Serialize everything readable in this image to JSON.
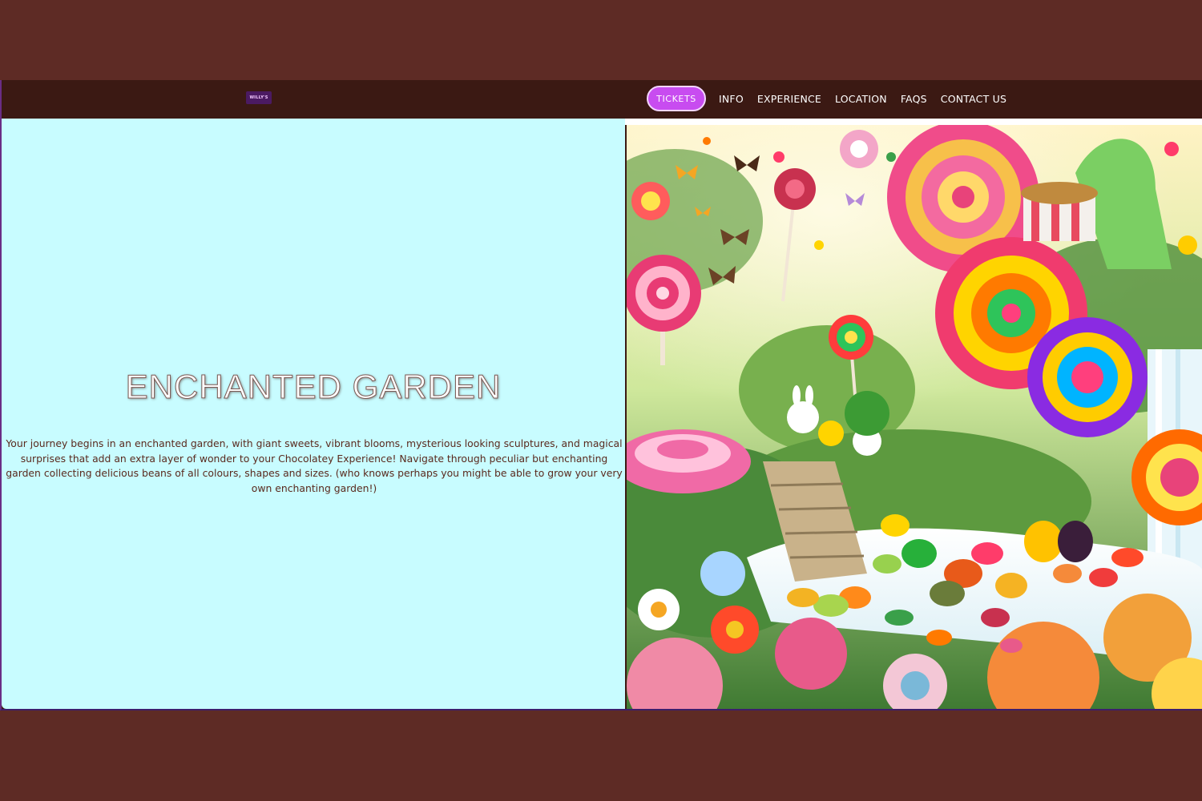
{
  "nav": {
    "logo_text": "WILLY'S",
    "tickets_label": "TICKETS",
    "items": [
      {
        "label": "INFO"
      },
      {
        "label": "EXPERIENCE"
      },
      {
        "label": "LOCATION"
      },
      {
        "label": "FAQS"
      },
      {
        "label": "CONTACT US"
      }
    ]
  },
  "main": {
    "heading": "ENCHANTED GARDEN",
    "paragraph": "Your journey begins in an enchanted garden, with giant  sweets, vibrant blooms, mysterious looking sculptures, and magical surprises that add an extra layer of wonder to your  Chocolatey Experience!  Navigate through peculiar but enchanting garden collecting delicious beans of all colours, shapes  and sizes.  (who knows perhaps you might be able to grow your very own enchanting garden!)"
  },
  "colors": {
    "page_background": "#5e2b25",
    "navbar": "#3b1913",
    "tickets_button": "#c84cf0",
    "text_panel": "#c8fcff",
    "body_text": "#5a2a1e"
  },
  "image": {
    "icon": "candy-garden-illustration"
  }
}
